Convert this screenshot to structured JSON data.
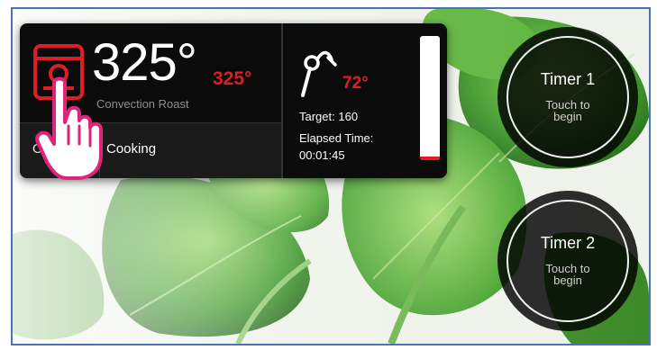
{
  "oven": {
    "current_temp": "325°",
    "set_temp": "325°",
    "mode": "Convection Roast",
    "button_left": "O",
    "button_right": "Cooking"
  },
  "probe": {
    "temp": "72°",
    "target": "Target: 160",
    "elapsed_label": "Elapsed Time:",
    "elapsed_value": "00:01:45",
    "gauge_fill_fraction": 0.03
  },
  "timers": [
    {
      "title": "Timer 1",
      "line1": "Touch to",
      "line2": "begin"
    },
    {
      "title": "Timer 2",
      "line1": "Touch to",
      "line2": "begin"
    }
  ],
  "colors": {
    "accent_red": "#e01d24",
    "panel_bg": "#0b0b0b",
    "frame_border": "#4a72b5",
    "hand_pink": "#e0247a"
  },
  "icons": [
    "oven-icon",
    "probe-icon",
    "hand-pointer-icon"
  ]
}
